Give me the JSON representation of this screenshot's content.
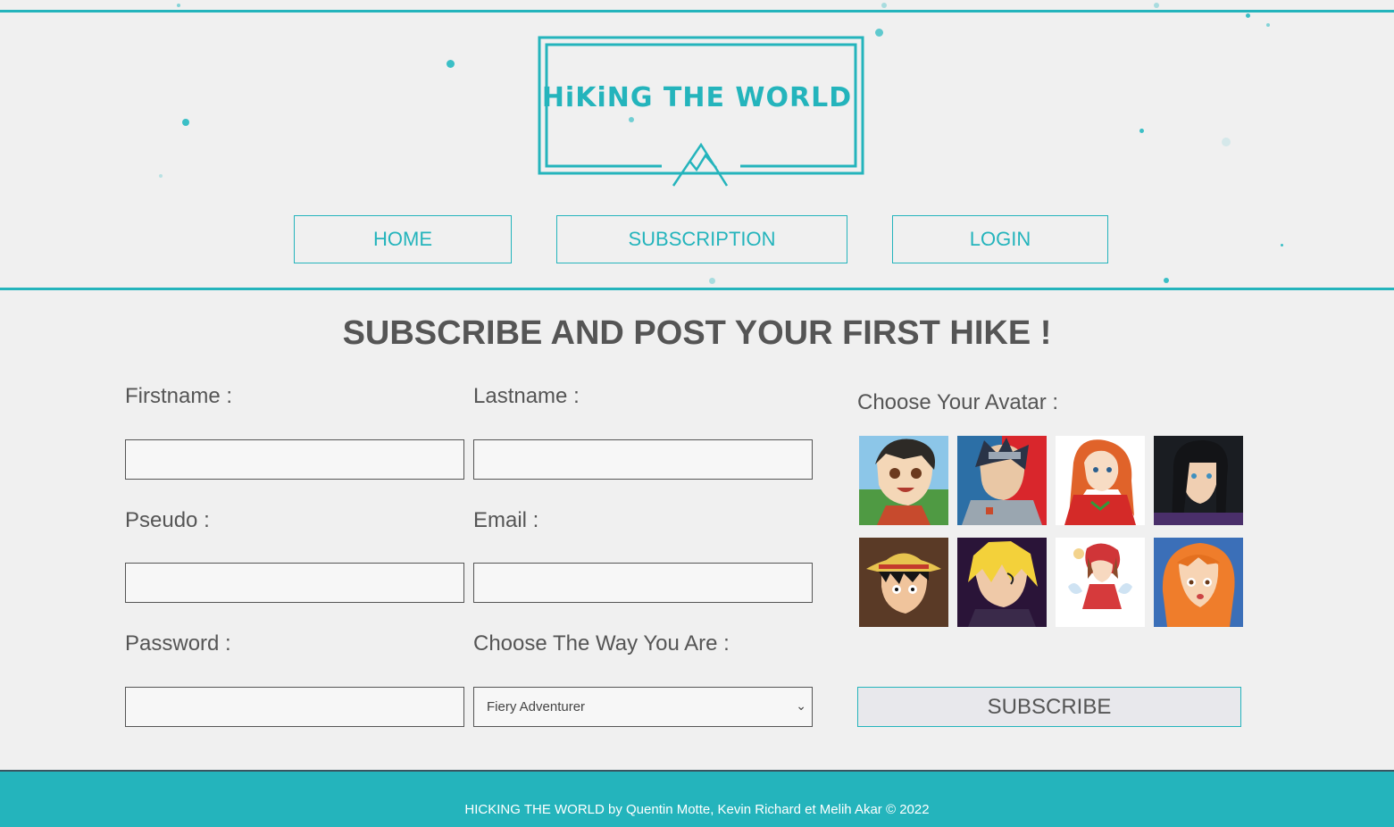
{
  "brand": {
    "logo_text": "HiKiNG THE WORLD",
    "accent_color": "#24b4bc"
  },
  "nav": [
    {
      "label": "HOME"
    },
    {
      "label": "SUBSCRIPTION"
    },
    {
      "label": "LOGIN"
    }
  ],
  "page_title": "SUBSCRIBE AND POST YOUR FIRST HIKE !",
  "form": {
    "firstname_label": "Firstname :",
    "lastname_label": "Lastname :",
    "pseudo_label": "Pseudo :",
    "email_label": "Email :",
    "password_label": "Password :",
    "way_label": "Choose The Way You Are :",
    "way_selected": "Fiery Adventurer",
    "avatar_label": "Choose Your Avatar :",
    "submit_label": "SUBSCRIBE"
  },
  "footer": {
    "text": "HICKING THE WORLD by Quentin Motte, Kevin Richard et Melih Akar © 2022"
  }
}
